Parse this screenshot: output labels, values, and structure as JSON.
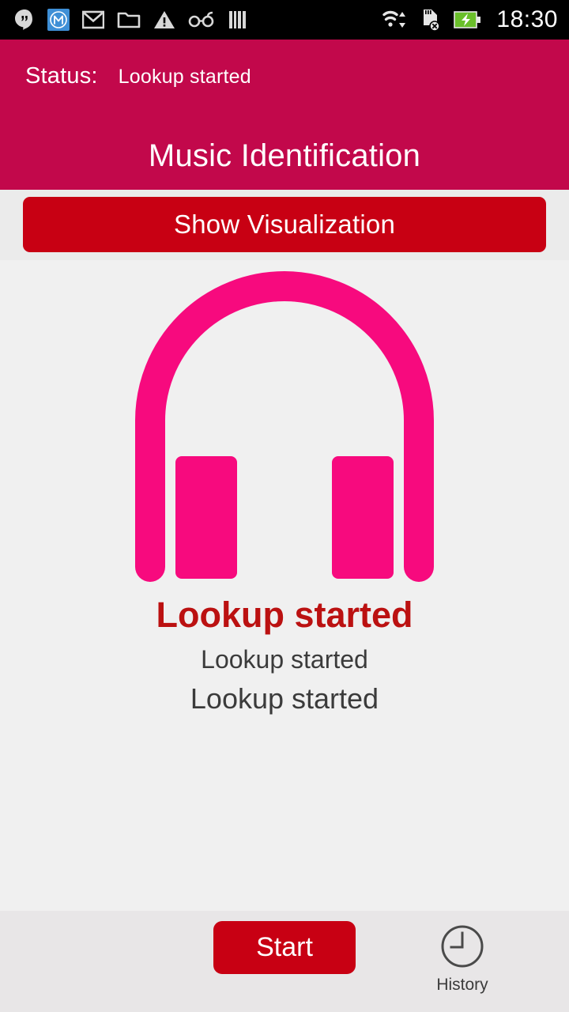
{
  "statusbar": {
    "icons_left": [
      {
        "name": "hangouts-icon",
        "label": "Hangouts"
      },
      {
        "name": "m-app-icon",
        "label": "M"
      },
      {
        "name": "gmail-icon",
        "label": "Gmail"
      },
      {
        "name": "folder-icon",
        "label": "Folder"
      },
      {
        "name": "warning-icon",
        "label": "Warning"
      },
      {
        "name": "glasses-icon",
        "label": "Glasses"
      },
      {
        "name": "barcode-icon",
        "label": "Barcode"
      }
    ],
    "icons_right": [
      {
        "name": "wifi-icon",
        "label": "WiFi"
      },
      {
        "name": "sdcard-removed-icon",
        "label": "SD card removed"
      },
      {
        "name": "battery-charging-icon",
        "label": "Battery charging"
      }
    ],
    "clock": "18:30"
  },
  "header": {
    "status_label": "Status:",
    "status_value": "Lookup started",
    "title": "Music Identification",
    "background_color": "#c2084b"
  },
  "toolbar": {
    "show_visualization_label": "Show Visualization",
    "button_color": "#c80013"
  },
  "main": {
    "artwork_icon": "headphones-icon",
    "artwork_color": "#f70a7e",
    "result_primary": "Lookup started",
    "result_primary_color": "#bb1111",
    "result_secondary": "Lookup started",
    "result_tertiary": "Lookup started"
  },
  "bottombar": {
    "start_label": "Start",
    "start_color": "#c80013",
    "history_icon": "clock-icon",
    "history_label": "History",
    "background_color": "#e8e6e7"
  }
}
